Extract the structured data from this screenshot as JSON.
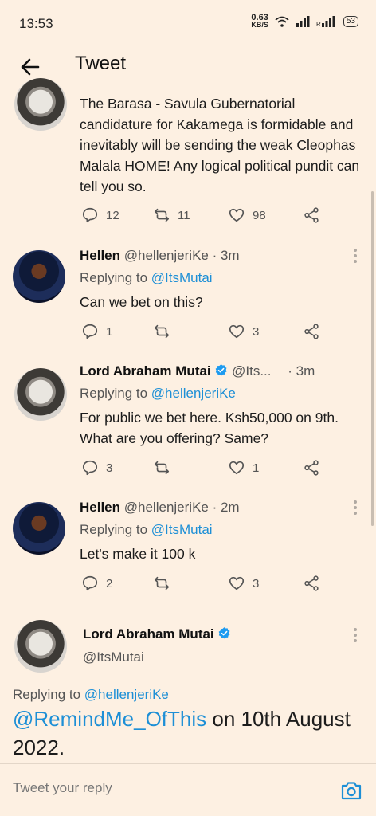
{
  "status_bar": {
    "time": "13:53",
    "net_speed": "0.63",
    "net_unit": "KB/S",
    "battery": "53"
  },
  "header": {
    "title": "Tweet"
  },
  "tweets": [
    {
      "text": "The Barasa - Savula Gubernatorial candidature for Kakamega is formidable and inevitably will be sending the weak Cleophas Malala HOME! Any logical political pundit can tell you so.",
      "replies": "12",
      "retweets": "11",
      "likes": "98"
    },
    {
      "name": "Hellen",
      "handle": "@hellenjeriKe",
      "time": "· 3m",
      "replying_label": "Replying to",
      "replying_to": "@ItsMutai",
      "text": "Can we bet on this?",
      "replies": "1",
      "retweets": "",
      "likes": "3"
    },
    {
      "name": "Lord Abraham Mutai",
      "handle": "@Its...",
      "time": "· 3m",
      "replying_label": "Replying to",
      "replying_to": "@hellenjeriKe",
      "text": "For public we bet here. Ksh50,000 on 9th. What are you offering? Same?",
      "replies": "3",
      "retweets": "",
      "likes": "1"
    },
    {
      "name": "Hellen",
      "handle": "@hellenjeriKe",
      "time": "· 2m",
      "replying_label": "Replying to",
      "replying_to": "@ItsMutai",
      "text": "Let's make it 100 k",
      "replies": "2",
      "retweets": "",
      "likes": "3"
    }
  ],
  "main_tweet": {
    "name": "Lord Abraham Mutai",
    "handle": "@ItsMutai",
    "replying_label": "Replying to",
    "replying_to": "@hellenjeriKe",
    "mention": "@RemindMe_OfThis",
    "text_rest": " on 10th August 2022."
  },
  "reply_bar": {
    "placeholder": "Tweet your reply"
  },
  "colors": {
    "background": "#fdf0e2",
    "link": "#1d8fd6",
    "verified": "#1d9bf0"
  },
  "icons": [
    "back-arrow-icon",
    "reply-icon",
    "retweet-icon",
    "like-icon",
    "share-icon",
    "more-icon",
    "verified-icon",
    "camera-icon",
    "wifi-icon",
    "signal-icon"
  ]
}
